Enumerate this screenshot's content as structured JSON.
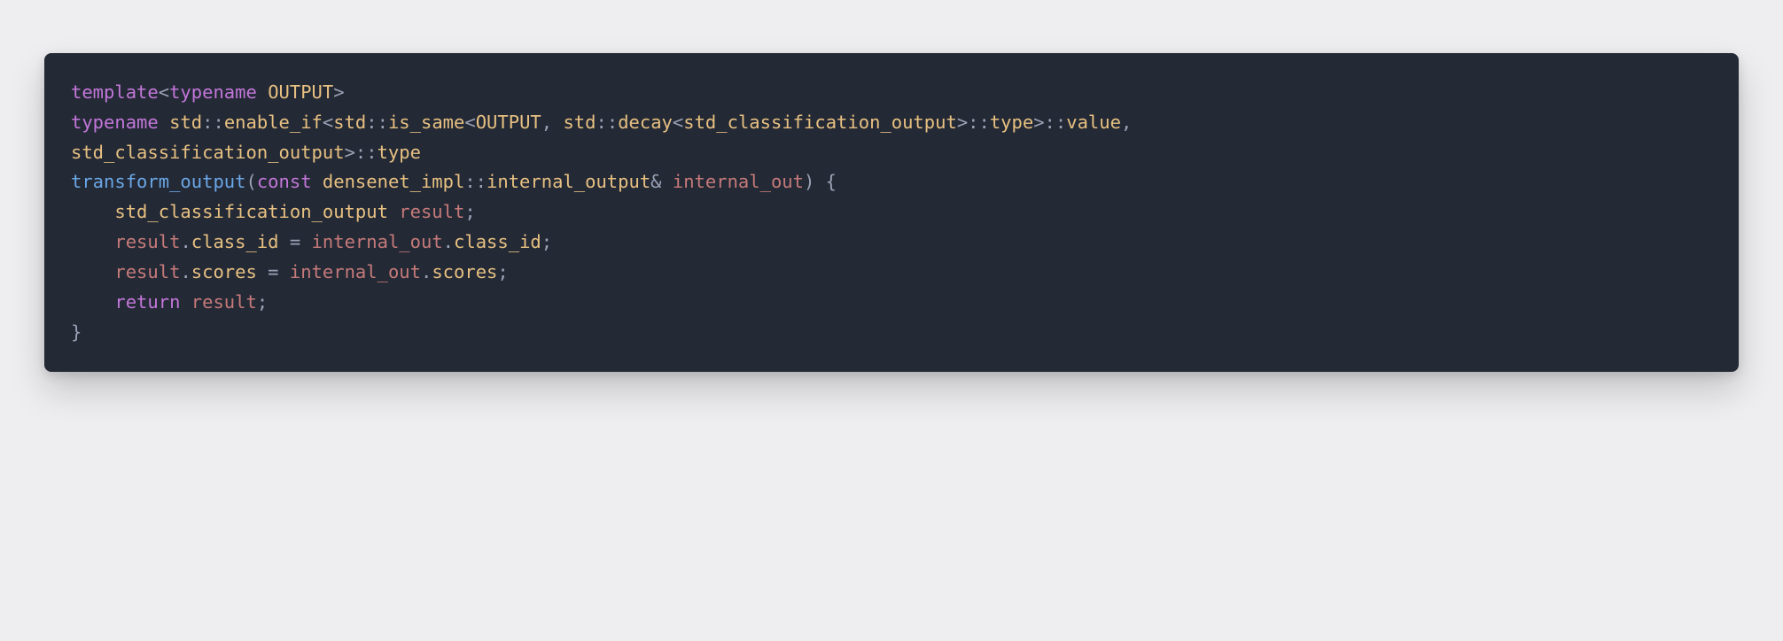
{
  "code": {
    "l1": {
      "t1": "template",
      "t2": "<",
      "t3": "typename",
      "t4": " ",
      "t5": "OUTPUT",
      "t6": ">"
    },
    "l2": {
      "t1": "typename",
      "t2": " ",
      "t3": "std",
      "t4": "::",
      "t5": "enable_if",
      "t6": "<",
      "t7": "std",
      "t8": "::",
      "t9": "is_same",
      "t10": "<",
      "t11": "OUTPUT",
      "t12": ", ",
      "t13": "std",
      "t14": "::",
      "t15": "decay",
      "t16": "<",
      "t17": "std_classification_output",
      "t18": ">::",
      "t19": "type",
      "t20": ">::",
      "t21": "value",
      "t22": ","
    },
    "l3": {
      "t1": "std_classification_output",
      "t2": ">::",
      "t3": "type"
    },
    "l4": {
      "t1": "transform_output",
      "t2": "(",
      "t3": "const",
      "t4": " ",
      "t5": "densenet_impl",
      "t6": "::",
      "t7": "internal_output",
      "t8": "& ",
      "t9": "internal_out",
      "t10": ") {"
    },
    "l5": {
      "t1": "    ",
      "t2": "std_classification_output",
      "t3": " ",
      "t4": "result",
      "t5": ";"
    },
    "l6": {
      "t1": "    ",
      "t2": "result",
      "t3": ".",
      "t4": "class_id",
      "t5": " = ",
      "t6": "internal_out",
      "t7": ".",
      "t8": "class_id",
      "t9": ";"
    },
    "l7": {
      "t1": "    ",
      "t2": "result",
      "t3": ".",
      "t4": "scores",
      "t5": " = ",
      "t6": "internal_out",
      "t7": ".",
      "t8": "scores",
      "t9": ";"
    },
    "l8": {
      "t1": "    ",
      "t2": "return",
      "t3": " ",
      "t4": "result",
      "t5": ";"
    },
    "l9": {
      "t1": "}"
    }
  }
}
